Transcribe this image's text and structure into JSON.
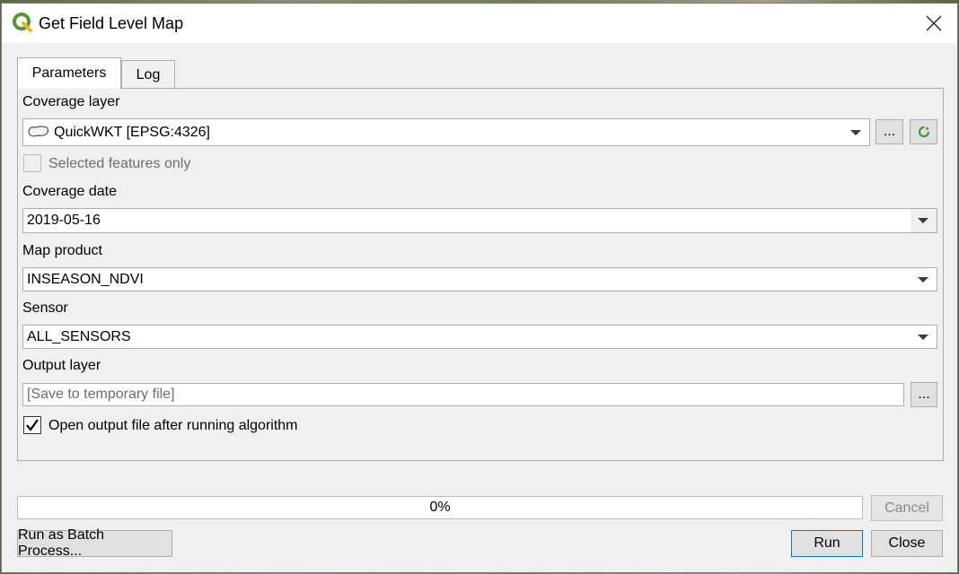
{
  "window": {
    "title": "Get Field Level Map"
  },
  "tabs": [
    {
      "label": "Parameters"
    },
    {
      "label": "Log"
    }
  ],
  "params": {
    "coverage_layer": {
      "label": "Coverage layer",
      "value": "QuickWKT [EPSG:4326]",
      "browse_label": "...",
      "selected_only_label": "Selected features only"
    },
    "coverage_date": {
      "label": "Coverage date",
      "value": "2019-05-16"
    },
    "map_product": {
      "label": "Map product",
      "value": "INSEASON_NDVI"
    },
    "sensor": {
      "label": "Sensor",
      "value": "ALL_SENSORS"
    },
    "output_layer": {
      "label": "Output layer",
      "placeholder": "[Save to temporary file]",
      "browse_label": "..."
    },
    "open_output": {
      "label": "Open output file after running algorithm",
      "checked": true
    }
  },
  "progress": {
    "value": 0,
    "text": "0%",
    "cancel_label": "Cancel"
  },
  "footer": {
    "batch_label": "Run as Batch Process...",
    "run_label": "Run",
    "close_label": "Close"
  },
  "colors": {
    "accent": "#0078d7",
    "qgis_green": "#589632"
  }
}
